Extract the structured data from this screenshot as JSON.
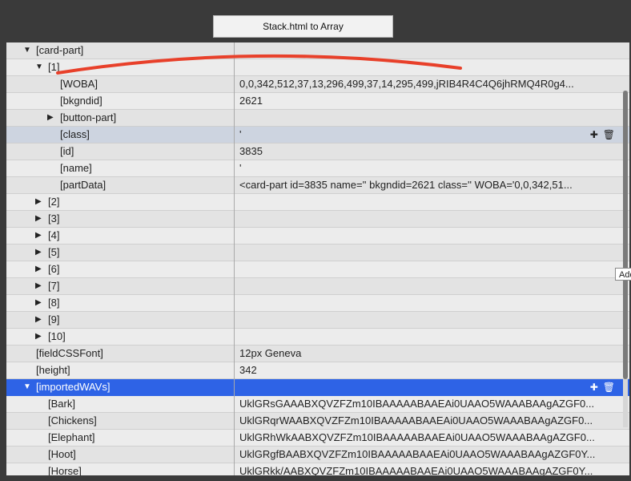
{
  "window": {
    "title_button": "Stack.html to Array",
    "tooltip": "Add"
  },
  "rows": [
    {
      "key": "[card-part]",
      "value": "",
      "depth": 1,
      "expander": "down",
      "style": "odd"
    },
    {
      "key": "[1]",
      "value": "",
      "depth": 2,
      "expander": "down",
      "style": "even"
    },
    {
      "key": "[WOBA]",
      "value": "0,0,342,512,37,13,296,499,37,14,295,499,jRIB4R4C4Q6jhRMQ4R0g4...",
      "depth": 4,
      "expander": "",
      "style": "odd"
    },
    {
      "key": "[bkgndid]",
      "value": "2621",
      "depth": 4,
      "expander": "",
      "style": "even"
    },
    {
      "key": "[button-part]",
      "value": "",
      "depth": 3,
      "expander": "right",
      "style": "odd"
    },
    {
      "key": "[class]",
      "value": "'",
      "depth": 4,
      "expander": "",
      "style": "selected-light",
      "actions": true
    },
    {
      "key": "[id]",
      "value": "3835",
      "depth": 4,
      "expander": "",
      "style": "odd"
    },
    {
      "key": "[name]",
      "value": "'",
      "depth": 4,
      "expander": "",
      "style": "even"
    },
    {
      "key": "[partData]",
      "value": "<card-part id=3835 name='' bkgndid=2621 class='' WOBA='0,0,342,51...",
      "depth": 4,
      "expander": "",
      "style": "odd"
    },
    {
      "key": "[2]",
      "value": "",
      "depth": 2,
      "expander": "right",
      "style": "even"
    },
    {
      "key": "[3]",
      "value": "",
      "depth": 2,
      "expander": "right",
      "style": "odd"
    },
    {
      "key": "[4]",
      "value": "",
      "depth": 2,
      "expander": "right",
      "style": "even"
    },
    {
      "key": "[5]",
      "value": "",
      "depth": 2,
      "expander": "right",
      "style": "odd"
    },
    {
      "key": "[6]",
      "value": "",
      "depth": 2,
      "expander": "right",
      "style": "even"
    },
    {
      "key": "[7]",
      "value": "",
      "depth": 2,
      "expander": "right",
      "style": "odd"
    },
    {
      "key": "[8]",
      "value": "",
      "depth": 2,
      "expander": "right",
      "style": "even"
    },
    {
      "key": "[9]",
      "value": "",
      "depth": 2,
      "expander": "right",
      "style": "odd"
    },
    {
      "key": "[10]",
      "value": "",
      "depth": 2,
      "expander": "right",
      "style": "even"
    },
    {
      "key": "[fieldCSSFont]",
      "value": "12px Geneva",
      "depth": 1,
      "expander": "",
      "style": "odd"
    },
    {
      "key": "[height]",
      "value": "342",
      "depth": 1,
      "expander": "",
      "style": "even"
    },
    {
      "key": "[importedWAVs]",
      "value": "",
      "depth": 1,
      "expander": "down",
      "style": "selected",
      "actions": true
    },
    {
      "key": "[Bark]",
      "value": "UklGRsGAAABXQVZFZm10IBAAAAABAAEAi0UAAO5WAAABAAgAZGF0...",
      "depth": 2,
      "expander": "",
      "style": "even"
    },
    {
      "key": "[Chickens]",
      "value": "UklGRqrWAABXQVZFZm10IBAAAAABAAEAi0UAAO5WAAABAAgAZGF0...",
      "depth": 2,
      "expander": "",
      "style": "odd"
    },
    {
      "key": "[Elephant]",
      "value": "UklGRhWkAABXQVZFZm10IBAAAAABAAEAi0UAAO5WAAABAAgAZGF0...",
      "depth": 2,
      "expander": "",
      "style": "even"
    },
    {
      "key": "[Hoot]",
      "value": "UklGRgfBAABXQVZFZm10IBAAAAABAAEAi0UAAO5WAAABAAgAZGF0Y...",
      "depth": 2,
      "expander": "",
      "style": "odd"
    },
    {
      "key": "[Horse]",
      "value": "UklGRkk/AABXQVZFZm10IBAAAAABAAEAi0UAAO5WAAABAAgAZGF0Y...",
      "depth": 2,
      "expander": "",
      "style": "even"
    }
  ],
  "icons": {
    "add": "plus-icon",
    "delete": "trash-icon"
  },
  "colors": {
    "selection": "#2e63e6",
    "highlight": "#cdd4e0",
    "annotation": "#e8402a"
  }
}
